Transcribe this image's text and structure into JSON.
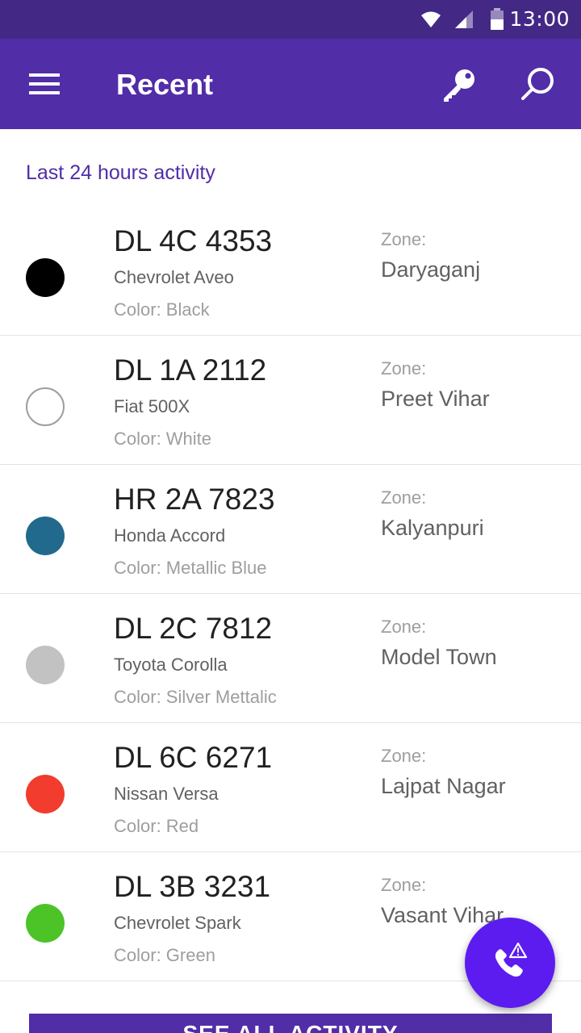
{
  "status_bar": {
    "time": "13:00",
    "icons": [
      "wifi-icon",
      "cell-signal-icon",
      "battery-icon"
    ]
  },
  "app_bar": {
    "title": "Recent",
    "icons": [
      "menu-icon",
      "key-icon",
      "search-icon"
    ]
  },
  "section": {
    "header": "Last 24 hours activity"
  },
  "vehicles": [
    {
      "plate": "DL 4C 4353",
      "model": "Chevrolet Aveo",
      "color_text": "Color: Black",
      "zone_label": "Zone:",
      "zone": "Daryaganj",
      "dot_color": "#000000"
    },
    {
      "plate": "DL 1A 2112",
      "model": "Fiat 500X",
      "color_text": "Color: White",
      "zone_label": "Zone:",
      "zone": "Preet Vihar",
      "dot_color": "#ffffff"
    },
    {
      "plate": "HR 2A 7823",
      "model": "Honda Accord",
      "color_text": "Color: Metallic Blue",
      "zone_label": "Zone:",
      "zone": "Kalyanpuri",
      "dot_color": "#226a8d"
    },
    {
      "plate": "DL 2C 7812",
      "model": "Toyota Corolla",
      "color_text": "Color: Silver Mettalic",
      "zone_label": "Zone:",
      "zone": "Model Town",
      "dot_color": "#c2c2c2"
    },
    {
      "plate": "DL 6C 6271",
      "model": "Nissan Versa",
      "color_text": "Color: Red",
      "zone_label": "Zone:",
      "zone": "Lajpat Nagar",
      "dot_color": "#f23c2d"
    },
    {
      "plate": "DL 3B 3231",
      "model": "Chevrolet Spark",
      "color_text": "Color: Green",
      "zone_label": "Zone:",
      "zone": "Vasant Vihar",
      "dot_color": "#4cc327"
    }
  ],
  "see_all_button": {
    "label": "SEE ALL ACTIVITY"
  },
  "fab": {
    "icon": "phone-alert-icon"
  },
  "colors": {
    "status_bar": "#432985",
    "app_bar": "#512da8",
    "accent_text": "#512da8",
    "fab": "#5c1cf0"
  }
}
